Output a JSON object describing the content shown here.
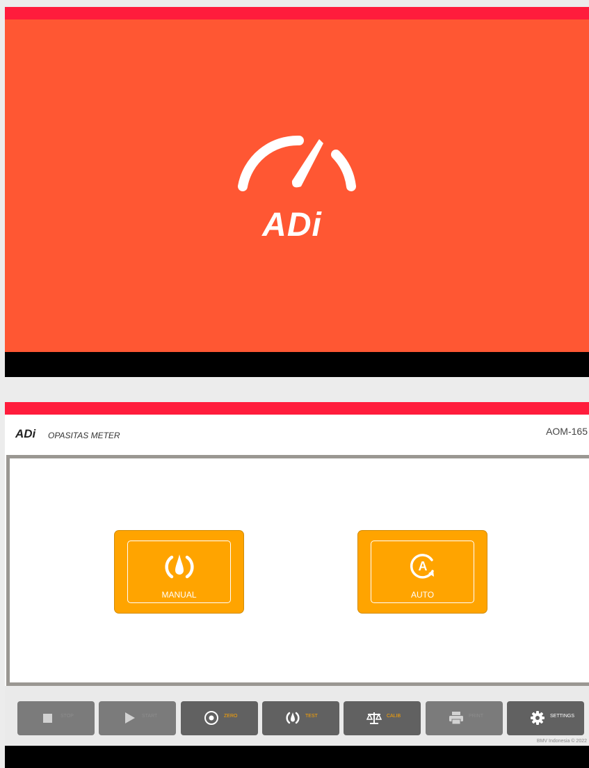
{
  "colors": {
    "red_bar": "#ff1c3c",
    "splash_bg": "#ff5733",
    "accent": "#ffa400",
    "toolbar_button": "#616161",
    "panel_border": "#9a9792"
  },
  "splash": {
    "logo_text": "ADi",
    "logo_icon": "gauge-needle-icon"
  },
  "header": {
    "brand": "ADi",
    "app_title": "OPASITAS METER",
    "model": "AOM-165"
  },
  "modes": [
    {
      "label": "MANUAL",
      "icon": "gauge-drop-icon"
    },
    {
      "label": "AUTO",
      "icon": "auto-cycle-icon"
    }
  ],
  "toolbar": [
    {
      "label": "STOP",
      "icon": "stop-icon",
      "enabled": false
    },
    {
      "label": "START",
      "icon": "play-icon",
      "enabled": false
    },
    {
      "label": "ZERO",
      "icon": "target-icon",
      "enabled": true
    },
    {
      "label": "TEST",
      "icon": "gauge-drop-icon",
      "enabled": true
    },
    {
      "label": "CALIB",
      "icon": "scale-icon",
      "enabled": true
    },
    {
      "label": "PRINT",
      "icon": "printer-icon",
      "enabled": false
    },
    {
      "label": "SETTINGS",
      "icon": "gear-icon",
      "enabled": true
    }
  ],
  "footer": {
    "copyright": "BMV Indonesia © 2022"
  }
}
